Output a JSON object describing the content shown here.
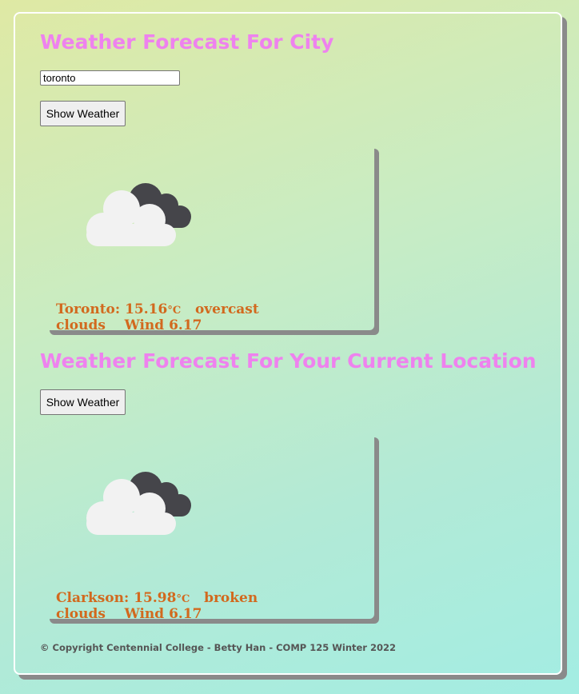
{
  "city_section": {
    "heading": "Weather Forecast For City",
    "input_value": "toronto",
    "button_label": "Show Weather",
    "result": {
      "icon": "overcast-clouds-icon",
      "city": "Toronto",
      "temp": "15.16",
      "unit": "°C",
      "description": "overcast clouds",
      "wind_label": "Wind",
      "wind_value": "6.17"
    }
  },
  "location_section": {
    "heading": "Weather Forecast For Your Current Location",
    "button_label": "Show Weather",
    "result": {
      "icon": "broken-clouds-icon",
      "city": "Clarkson",
      "temp": "15.98",
      "unit": "°C",
      "description": "broken clouds",
      "wind_label": "Wind",
      "wind_value": "6.17"
    }
  },
  "footer": {
    "text": "©  Copyright Centennial College - Betty Han - COMP 125 Winter 2022"
  },
  "colors": {
    "heading": "#ee82ee",
    "result_text": "#d2691e",
    "cloud_dark": "#45454a",
    "cloud_light": "#f2f2f2"
  }
}
